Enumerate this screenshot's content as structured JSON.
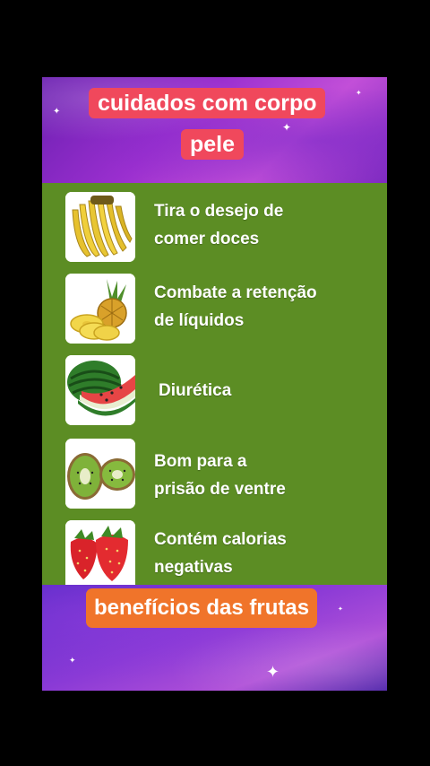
{
  "header": {
    "line1": "cuidados com corpo",
    "line2": "pele"
  },
  "fruits": [
    {
      "icon": "banana-icon",
      "benefit": "Tira o desejo de\ncomer doces"
    },
    {
      "icon": "pineapple-icon",
      "benefit": "Combate a retenção\nde líquidos"
    },
    {
      "icon": "watermelon-icon",
      "benefit": "Diurética"
    },
    {
      "icon": "kiwi-icon",
      "benefit": "Bom para a\nprisão de ventre"
    },
    {
      "icon": "strawberry-icon",
      "benefit": "Contém calorias\nnegativas"
    }
  ],
  "footer": {
    "label": "benefícios das frutas"
  },
  "colors": {
    "panel_green": "#5c8d24",
    "title_tag": "#f0485c",
    "footer_tag": "#f0742a",
    "background": "#000000"
  }
}
